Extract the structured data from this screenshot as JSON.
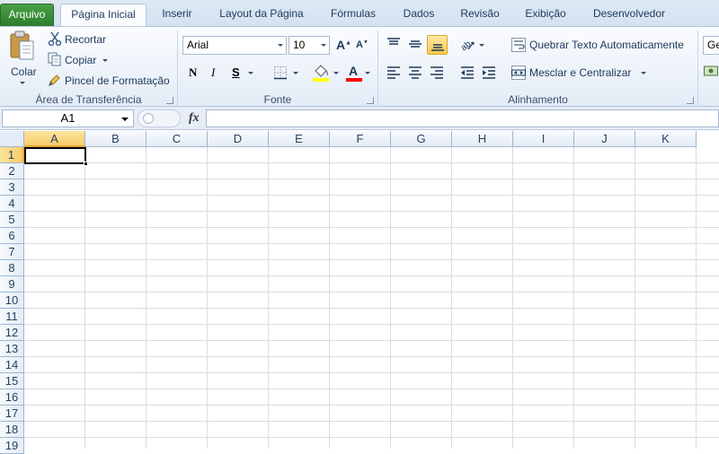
{
  "tabs": [
    "Arquivo",
    "Página Inicial",
    "Inserir",
    "Layout da Página",
    "Fórmulas",
    "Dados",
    "Revisão",
    "Exibição",
    "Desenvolvedor"
  ],
  "clipboard": {
    "paste_label": "Colar",
    "cut_label": "Recortar",
    "copy_label": "Copiar",
    "format_painter_label": "Pincel de Formatação",
    "group_label": "Área de Transferência"
  },
  "font": {
    "name": "Arial",
    "size": "10",
    "bold_label": "N",
    "italic_label": "I",
    "underline_label": "S",
    "group_label": "Fonte",
    "fill_color": "#ffff00",
    "text_color": "#ff0000"
  },
  "alignment": {
    "wrap_text_label": "Quebrar Texto Automaticamente",
    "merge_label": "Mesclar e Centralizar",
    "group_label": "Alinhamento"
  },
  "next_group": {
    "partial_label": "Ge"
  },
  "formula_bar": {
    "name_box": "A1",
    "fx_label": "fx",
    "formula": ""
  },
  "grid": {
    "columns": [
      "A",
      "B",
      "C",
      "D",
      "E",
      "F",
      "G",
      "H",
      "I",
      "J",
      "K"
    ],
    "rows": [
      "1",
      "2",
      "3",
      "4",
      "5",
      "6",
      "7",
      "8",
      "9",
      "10",
      "11",
      "12",
      "13",
      "14",
      "15",
      "16",
      "17",
      "18",
      "19"
    ],
    "active_cell": "A1"
  }
}
